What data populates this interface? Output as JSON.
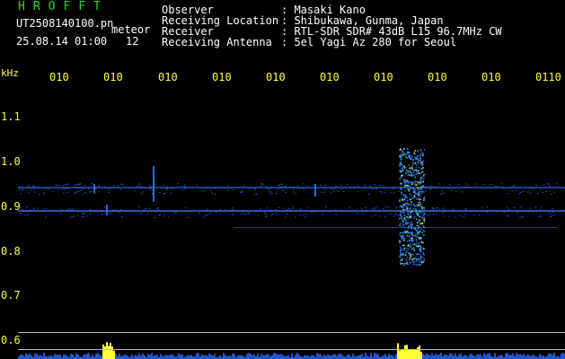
{
  "header": {
    "program": "HROFFT",
    "file_name": "UT2508140100.pn",
    "meteor_label": "meteor",
    "date_time": "25.08.14 01:00",
    "count": "12",
    "fields": [
      {
        "label": "Observer",
        "value": ": Masaki Kano"
      },
      {
        "label": "Receiving Location",
        "value": ": Shibukawa, Gunma, Japan"
      },
      {
        "label": "Receiver",
        "value": ": RTL-SDR SDR# 43dB L15 96.7MHz CW"
      },
      {
        "label": "Receiving Antenna",
        "value": ": 5el Yagi Az 280 for Seoul"
      }
    ]
  },
  "axes": {
    "freq_unit": "kHz",
    "time_ticks": [
      "010",
      "010",
      "010",
      "010",
      "010",
      "010",
      "010",
      "010",
      "010",
      "0110"
    ],
    "freq_ticks": [
      {
        "label": "1.1",
        "value": 1.1
      },
      {
        "label": "1.0",
        "value": 1.0
      },
      {
        "label": "0.9",
        "value": 0.9
      },
      {
        "label": "0.8",
        "value": 0.8
      },
      {
        "label": "0.7",
        "value": 0.7
      },
      {
        "label": "0.6",
        "value": 0.6
      }
    ]
  },
  "colors": {
    "title": "#22dd22",
    "text": "#ffffff",
    "axis": "#ffff33",
    "signal": "#3377ff",
    "burst": "#ffff33"
  }
}
